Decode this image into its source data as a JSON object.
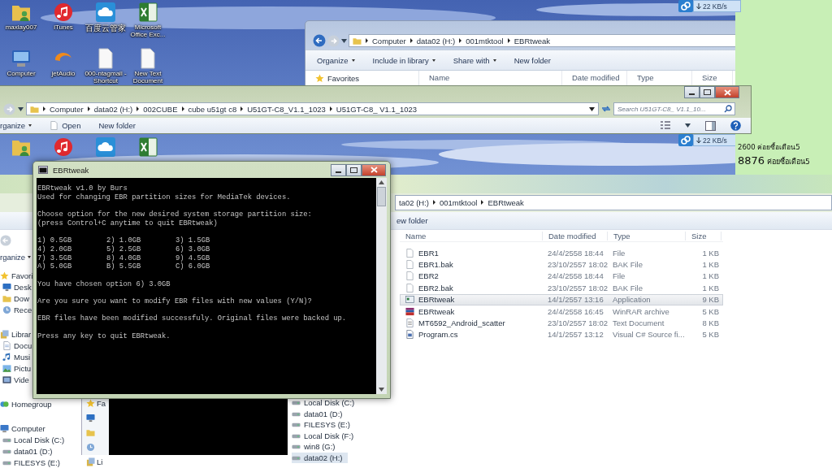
{
  "desktop": {
    "icons": [
      {
        "label": "maxlay007",
        "kind": "user-folder"
      },
      {
        "label": "iTunes",
        "kind": "music"
      },
      {
        "label": "百度云管家",
        "kind": "cloud"
      },
      {
        "label": "Microsoft Office Exc...",
        "kind": "spreadsheet"
      },
      {
        "label": "Computer",
        "kind": "computer"
      },
      {
        "label": "jetAudio",
        "kind": "audio"
      },
      {
        "label": "000-ntagmall - Shortcut",
        "kind": "document"
      },
      {
        "label": "New Text Document",
        "kind": "document"
      }
    ],
    "ghost_icons": [
      {
        "kind": "user-folder"
      },
      {
        "kind": "music"
      },
      {
        "kind": "cloud"
      },
      {
        "kind": "spreadsheet"
      }
    ]
  },
  "net_meters": [
    {
      "reading": "22 KB/s"
    },
    {
      "reading": "22 KB/s"
    }
  ],
  "note_panel": {
    "lines": [
      {
        "amount": "2600",
        "text": "ค่อยซื้อเดือน5",
        "kind": "minor"
      },
      {
        "amount": "8876",
        "text": "ค่อยซื้อเดือน5",
        "kind": "major"
      }
    ]
  },
  "back_explorer": {
    "breadcrumb": [
      "Computer",
      "data02 (H:)",
      "001mtktool",
      "EBRtweak"
    ],
    "toolbar": [
      {
        "label": "Organize",
        "menu": true
      },
      {
        "label": "Include in library",
        "menu": true
      },
      {
        "label": "Share with",
        "menu": true
      },
      {
        "label": "New folder",
        "menu": false
      }
    ],
    "nav_heading": "Favorites",
    "columns": [
      "Name",
      "Date modified",
      "Type",
      "Size"
    ]
  },
  "middle_explorer": {
    "breadcrumb": [
      "Computer",
      "data02 (H:)",
      "002CUBE",
      "cube u51gt c8",
      "U51GT-C8_V1.1_1023",
      "U51GT-C8_ V1.1_1023"
    ],
    "search_placeholder": "Search U51GT-C8_ V1.1_10...",
    "toolbar": [
      {
        "label": "rganize",
        "menu": true,
        "has_icon": false
      },
      {
        "label": "Open",
        "menu": false,
        "has_icon": true
      },
      {
        "label": "New folder",
        "menu": false,
        "has_icon": false
      }
    ]
  },
  "console": {
    "title": "EBRtweak",
    "intro": [
      [
        "EBRtweak v1.0 by Burs",
        "Used for changing EBR partition sizes for MediaTek devices."
      ],
      [
        "Choose option for the new desired system storage partition size:",
        "(press Control+C anytime to quit EBRtweak)"
      ]
    ],
    "options": [
      [
        "1) 0.5GB",
        "2) 1.0GB",
        "3) 1.5GB"
      ],
      [
        "4) 2.0GB",
        "5) 2.5GB",
        "6) 3.0GB"
      ],
      [
        "7) 3.5GB",
        "8) 4.0GB",
        "9) 4.5GB"
      ],
      [
        "A) 5.0GB",
        "B) 5.5GB",
        "C) 6.0GB"
      ]
    ],
    "messages": [
      "You have chosen option 6) 3.0GB",
      "Are you sure you want to modify EBR files with new values (Y/N)?",
      "EBR files have been modified successfuly. Original files were backed up.",
      "Press any key to quit EBRtweak."
    ]
  },
  "lower_explorer": {
    "breadcrumb": [
      "ta02 (H:)",
      "001mtktool",
      "EBRtweak"
    ],
    "toolbar_label": "ew folder",
    "side_toolbar": {
      "label": "rganize",
      "menu": true
    },
    "nav": [
      {
        "label": "Favori",
        "kind": "star",
        "children": [
          {
            "label": "Desk",
            "kind": "monitor"
          },
          {
            "label": "Dow",
            "kind": "folder"
          },
          {
            "label": "Rece",
            "kind": "clock"
          }
        ]
      },
      {
        "label": "Librar",
        "kind": "library",
        "children": [
          {
            "label": "Docu",
            "kind": "document"
          },
          {
            "label": "Musi",
            "kind": "music"
          },
          {
            "label": "Pictu",
            "kind": "picture"
          },
          {
            "label": "Vide",
            "kind": "video"
          }
        ]
      },
      {
        "label": "Homegroup",
        "kind": "group"
      },
      {
        "label": "Computer",
        "kind": "computer",
        "children": [
          {
            "label": "Local Disk (C:)",
            "kind": "drive"
          },
          {
            "label": "data01 (D:)",
            "kind": "drive"
          },
          {
            "label": "FILESYS (E:)",
            "kind": "drive"
          }
        ]
      }
    ],
    "columns": [
      "Name",
      "Date modified",
      "Type",
      "Size"
    ],
    "files": [
      {
        "name": "EBR1",
        "date": "24/4/2558 18:44",
        "type": "File",
        "size": "1 KB",
        "kind": "file",
        "selected": false
      },
      {
        "name": "EBR1.bak",
        "date": "23/10/2557 18:02",
        "type": "BAK File",
        "size": "1 KB",
        "kind": "file",
        "selected": false
      },
      {
        "name": "EBR2",
        "date": "24/4/2558 18:44",
        "type": "File",
        "size": "1 KB",
        "kind": "file",
        "selected": false
      },
      {
        "name": "EBR2.bak",
        "date": "23/10/2557 18:02",
        "type": "BAK File",
        "size": "1 KB",
        "kind": "file",
        "selected": false
      },
      {
        "name": "EBRtweak",
        "date": "14/1/2557 13:16",
        "type": "Application",
        "size": "9 KB",
        "kind": "app",
        "selected": true
      },
      {
        "name": "EBRtweak",
        "date": "24/4/2558 16:45",
        "type": "WinRAR archive",
        "size": "5 KB",
        "kind": "archive",
        "selected": false
      },
      {
        "name": "MT6592_Android_scatter",
        "date": "23/10/2557 18:02",
        "type": "Text Document",
        "size": "8 KB",
        "kind": "text",
        "selected": false
      },
      {
        "name": "Program.cs",
        "date": "14/1/2557 13:12",
        "type": "Visual C# Source fi...",
        "size": "5 KB",
        "kind": "code",
        "selected": false
      }
    ],
    "inner_window": {
      "nav": [
        {
          "label": "Fa",
          "kind": "star"
        },
        {
          "kind": "monitor"
        },
        {
          "kind": "folder"
        },
        {
          "kind": "clock"
        },
        {
          "label": "Li",
          "kind": "library"
        }
      ],
      "drives": [
        {
          "label": "Local Disk (C:)",
          "selected": false
        },
        {
          "label": "data01 (D:)",
          "selected": false
        },
        {
          "label": "FILESYS (E:)",
          "selected": false
        },
        {
          "label": "Local Disk (F:)",
          "selected": false
        },
        {
          "label": "win8 (G:)",
          "selected": false
        },
        {
          "label": "data02 (H:)",
          "selected": true
        }
      ]
    }
  }
}
